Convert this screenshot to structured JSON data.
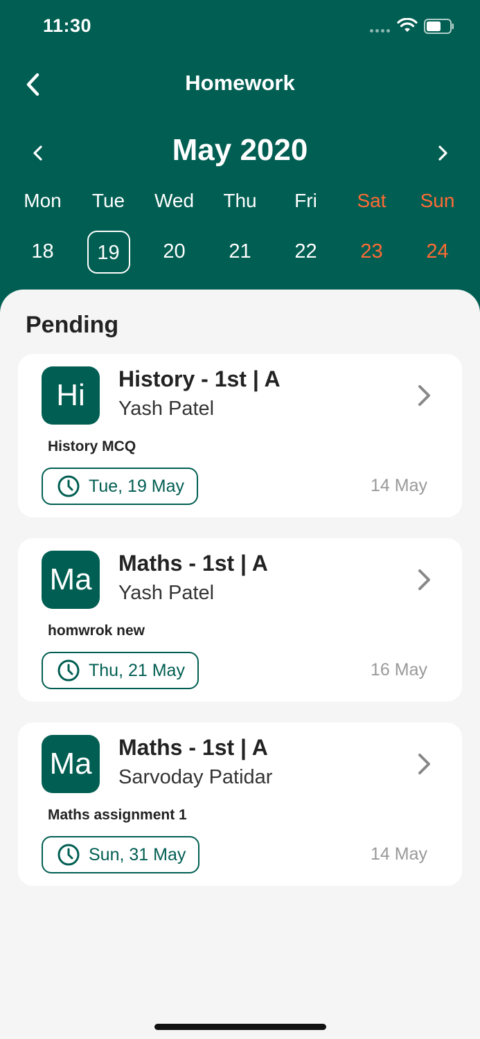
{
  "status_bar": {
    "time": "11:30"
  },
  "nav": {
    "title": "Homework",
    "back_icon": "chevron-left-icon"
  },
  "calendar": {
    "month_label": "May 2020",
    "weekdays": [
      "Mon",
      "Tue",
      "Wed",
      "Thu",
      "Fri",
      "Sat",
      "Sun"
    ],
    "dates": [
      "18",
      "19",
      "20",
      "21",
      "22",
      "23",
      "24"
    ],
    "selected_date": "19",
    "weekend_color": "#ff6b35"
  },
  "section": {
    "title": "Pending"
  },
  "homework": [
    {
      "avatar": "Hi",
      "title": "History - 1st | A",
      "teacher": "Yash Patel",
      "description": "History MCQ",
      "due": "Tue, 19 May",
      "assigned": "14 May"
    },
    {
      "avatar": "Ma",
      "title": "Maths - 1st | A",
      "teacher": "Yash Patel",
      "description": "homwrok new",
      "due": "Thu, 21 May",
      "assigned": "16 May"
    },
    {
      "avatar": "Ma",
      "title": "Maths - 1st | A",
      "teacher": "Sarvoday Patidar",
      "description": "Maths assignment 1",
      "due": "Sun, 31 May",
      "assigned": "14 May"
    }
  ],
  "colors": {
    "primary": "#015e52",
    "background": "#f5f5f5",
    "card": "#ffffff",
    "muted": "#999999"
  }
}
